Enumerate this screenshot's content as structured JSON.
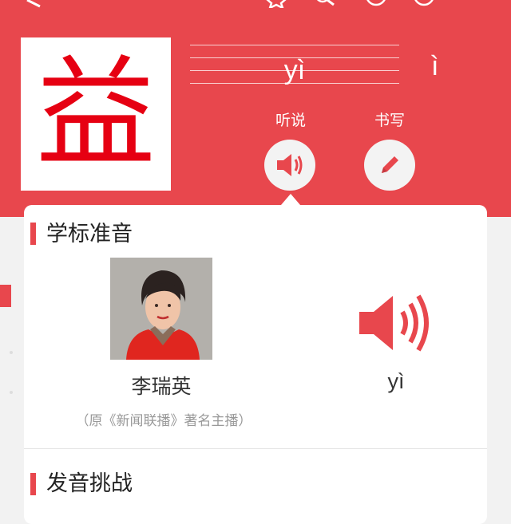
{
  "character": "益",
  "pinyin": "yì",
  "tone_display": "ì",
  "actions": [
    {
      "label": "听说",
      "icon": "speaker-icon"
    },
    {
      "label": "书写",
      "icon": "pencil-icon"
    }
  ],
  "standard_pronunciation": {
    "title": "学标准音",
    "speaker_name": "李瑞英",
    "speaker_note": "（原《新闻联播》著名主播）",
    "pinyin": "yì",
    "play_icon": "speaker-icon"
  },
  "challenge": {
    "title": "发音挑战"
  },
  "colors": {
    "accent": "#e8474d",
    "character": "#e60012"
  }
}
